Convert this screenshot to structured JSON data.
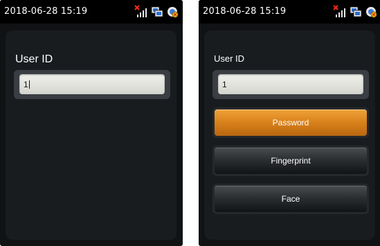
{
  "left_screen": {
    "status_time": "2018-06-28 15:19",
    "user_id_label": "User ID",
    "user_id_value": "1"
  },
  "right_screen": {
    "status_time": "2018-06-28 15:19",
    "user_id_label": "User ID",
    "user_id_value": "1",
    "buttons": [
      {
        "label": "Password",
        "style": "primary"
      },
      {
        "label": "Fingerprint",
        "style": "dark"
      },
      {
        "label": "Face",
        "style": "dark"
      }
    ]
  },
  "status_icons": [
    "signal-off-icon",
    "network-icon",
    "camera-icon"
  ],
  "colors": {
    "accent_orange": "#d8811a",
    "background": "#101214",
    "status_error": "#ff2a1a"
  }
}
